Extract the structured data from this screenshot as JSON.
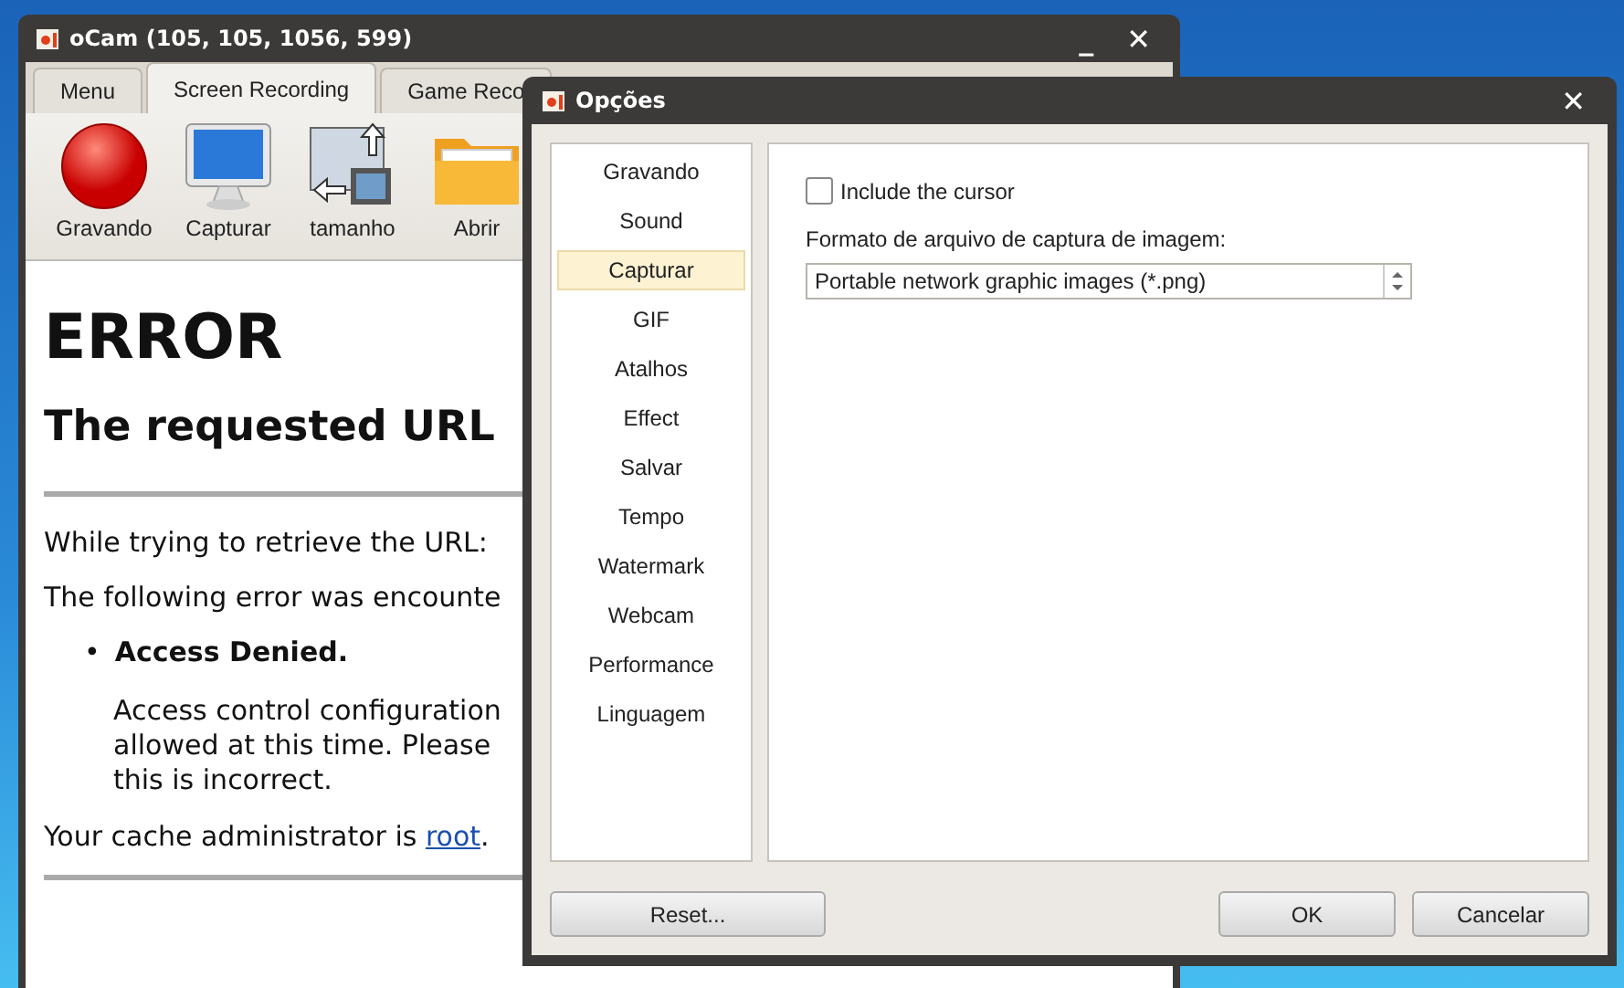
{
  "ocam_window": {
    "title": "oCam (105, 105, 1056, 599)",
    "window_controls": [
      "_",
      "✕"
    ],
    "tabs": [
      {
        "label": "Menu",
        "selected": false
      },
      {
        "label": "Screen Recording",
        "selected": true
      },
      {
        "label": "Game Reco",
        "selected": false
      }
    ],
    "toolbar": [
      {
        "label": "Gravando",
        "kind": "record"
      },
      {
        "label": "Capturar",
        "kind": "monitor"
      },
      {
        "label": "tamanho",
        "kind": "resize"
      },
      {
        "label": "Abrir",
        "kind": "folder"
      }
    ],
    "page": {
      "heading": "ERROR",
      "subheading": "The requested URL",
      "paragraph_1": "While trying to retrieve the URL:",
      "paragraph_2": "The following error was encounte",
      "bullet_marker": "•",
      "bullet": "Access Denied.",
      "bullet_text_lines": [
        "Access control configuration",
        "allowed at this time. Please",
        "this is incorrect."
      ],
      "admin_text": "Your cache administrator is ",
      "admin_link": "root",
      "admin_end": "."
    }
  },
  "options_dialog": {
    "title": "Opções",
    "close_button": "✕",
    "categories": [
      {
        "label": "Gravando",
        "selected": false
      },
      {
        "label": "Sound",
        "selected": false
      },
      {
        "label": "Capturar",
        "selected": true
      },
      {
        "label": "GIF",
        "selected": false
      },
      {
        "label": "Atalhos",
        "selected": false
      },
      {
        "label": "Effect",
        "selected": false
      },
      {
        "label": "Salvar",
        "selected": false
      },
      {
        "label": "Tempo",
        "selected": false
      },
      {
        "label": "Watermark",
        "selected": false
      },
      {
        "label": "Webcam",
        "selected": false
      },
      {
        "label": "Performance",
        "selected": false
      },
      {
        "label": "Linguagem",
        "selected": false
      }
    ],
    "include_cursor": {
      "label": "Include the cursor",
      "checked": false
    },
    "format_label": "Formato de arquivo de captura de imagem:",
    "format_select": "Portable network graphic images (*.png)",
    "buttons": [
      "Reset...",
      "OK",
      "Cancelar"
    ]
  }
}
